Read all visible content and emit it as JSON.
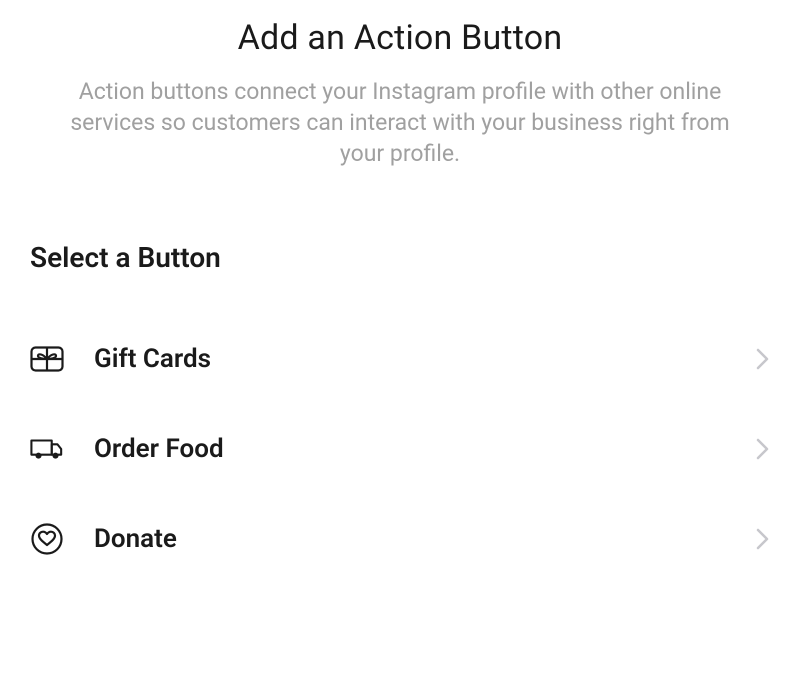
{
  "header": {
    "title": "Add an Action Button",
    "description": "Action buttons connect your Instagram profile with other online services so customers can interact with your business right from your profile."
  },
  "section": {
    "title": "Select a Button"
  },
  "options": [
    {
      "icon": "gift-card-icon",
      "label": "Gift Cards"
    },
    {
      "icon": "truck-icon",
      "label": "Order Food"
    },
    {
      "icon": "heart-circle-icon",
      "label": "Donate"
    }
  ]
}
